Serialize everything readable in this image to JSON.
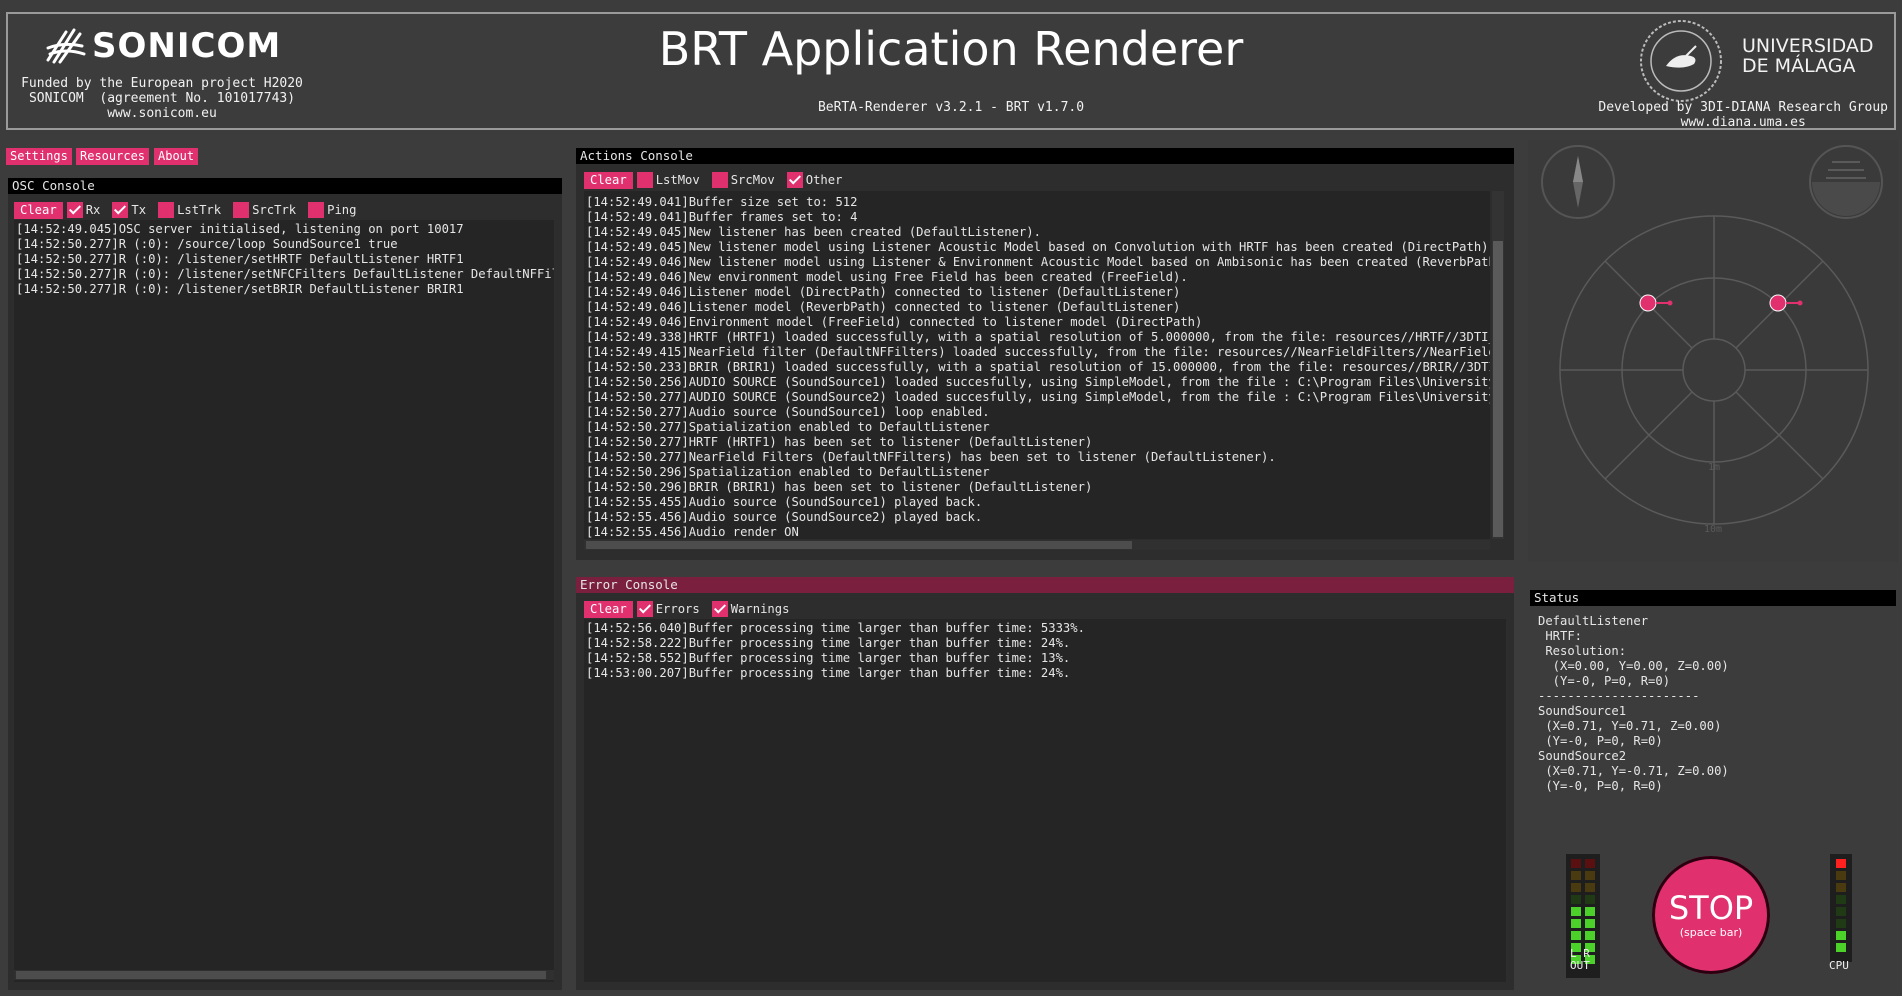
{
  "header": {
    "logo_text": "SONICOM",
    "funded_text": "Funded by the European project H2020\nSONICOM  (agreement No. 101017743)\nwww.sonicom.eu",
    "title": "BRT Application Renderer",
    "version": "BeRTA-Renderer v3.2.1 - BRT v1.7.0",
    "university": "UNIVERSIDAD\nDE MÁLAGA",
    "developed": "Developed by 3DI-DIANA Research Group\nwww.diana.uma.es"
  },
  "menu": {
    "settings": "Settings",
    "resources": "Resources",
    "about": "About"
  },
  "osc_console": {
    "title": "OSC Console",
    "clear": "Clear",
    "filters": [
      {
        "label": "Rx",
        "checked": true
      },
      {
        "label": "Tx",
        "checked": true
      },
      {
        "label": "LstTrk",
        "checked": false
      },
      {
        "label": "SrcTrk",
        "checked": false
      },
      {
        "label": "Ping",
        "checked": false
      }
    ],
    "log": "[14:52:49.045]OSC server initialised, listening on port 10017\n[14:52:50.277]R (:0): /source/loop SoundSource1 true\n[14:52:50.277]R (:0): /listener/setHRTF DefaultListener HRTF1\n[14:52:50.277]R (:0): /listener/setNFCFilters DefaultListener DefaultNFFilter\n[14:52:50.277]R (:0): /listener/setBRIR DefaultListener BRIR1"
  },
  "actions_console": {
    "title": "Actions Console",
    "clear": "Clear",
    "filters": [
      {
        "label": "LstMov",
        "checked": false
      },
      {
        "label": "SrcMov",
        "checked": false
      },
      {
        "label": "Other",
        "checked": true
      }
    ],
    "log": "[14:52:49.041]Buffer size set to: 512\n[14:52:49.041]Buffer frames set to: 4\n[14:52:49.045]New listener has been created (DefaultListener).\n[14:52:49.045]New listener model using Listener Acoustic Model based on Convolution with HRTF has been created (DirectPath).\n[14:52:49.046]New listener model using Listener & Environment Acoustic Model based on Ambisonic has been created (ReverbPath).\n[14:52:49.046]New environment model using Free Field has been created (FreeField).\n[14:52:49.046]Listener model (DirectPath) connected to listener (DefaultListener)\n[14:52:49.046]Listener model (ReverbPath) connected to listener (DefaultListener)\n[14:52:49.046]Environment model (FreeField) connected to listener model (DirectPath)\n[14:52:49.338]HRTF (HRTF1) loaded successfully, with a spatial resolution of 5.000000, from the file: resources//HRTF//3DTI_HRTF_S\n[14:52:49.415]NearField filter (DefaultNFFilters) loaded successfully, from the file: resources//NearFieldFilters//NearFieldCompen\n[14:52:50.233]BRIR (BRIR1) loaded successfully, with a spatial resolution of 15.000000, from the file: resources//BRIR//3DTI_BRIR_\n[14:52:50.256]AUDIO SOURCE (SoundSource1) loaded succesfully, using SimpleModel, from the file : C:\\Program Files\\University of Ma\n[14:52:50.277]AUDIO SOURCE (SoundSource2) loaded succesfully, using SimpleModel, from the file : C:\\Program Files\\University of Ma\n[14:52:50.277]Audio source (SoundSource1) loop enabled.\n[14:52:50.277]Spatialization enabled to DefaultListener\n[14:52:50.277]HRTF (HRTF1) has been set to listener (DefaultListener)\n[14:52:50.277]NearField Filters (DefaultNFFilters) has been set to listener (DefaultListener).\n[14:52:50.296]Spatialization enabled to DefaultListener\n[14:52:50.296]BRIR (BRIR1) has been set to listener (DefaultListener)\n[14:52:55.455]Audio source (SoundSource1) played back.\n[14:52:55.456]Audio source (SoundSource2) played back.\n[14:52:55.456]Audio render ON"
  },
  "error_console": {
    "title": "Error Console",
    "clear": "Clear",
    "filters": [
      {
        "label": "Errors",
        "checked": true
      },
      {
        "label": "Warnings",
        "checked": true
      }
    ],
    "log": "[14:52:56.040]Buffer processing time larger than buffer time: 5333%.\n[14:52:58.222]Buffer processing time larger than buffer time: 24%.\n[14:52:58.552]Buffer processing time larger than buffer time: 13%.\n[14:53:00.207]Buffer processing time larger than buffer time: 24%."
  },
  "radar": {
    "label_1m": "1m",
    "label_10m": "10m"
  },
  "status": {
    "title": "Status",
    "text": "DefaultListener\n HRTF:\n Resolution:\n  (X=0.00, Y=0.00, Z=0.00)\n  (Y=-0, P=0, R=0)\n----------------------\nSoundSource1\n (X=0.71, Y=0.71, Z=0.00)\n (Y=-0, P=0, R=0)\nSoundSource2\n (X=0.71, Y=-0.71, Z=0.00)\n (Y=-0, P=0, R=0)"
  },
  "meters": {
    "lr_label": "L R",
    "out_label": "OUT",
    "cpu_label": "CPU",
    "left_level": 0.5,
    "right_level": 0.5,
    "cpu_level": 0.3
  },
  "stop": {
    "label": "STOP",
    "hint": "(space bar)"
  },
  "colors": {
    "accent": "#e0306e",
    "background": "#3c3c3c",
    "console": "#252525",
    "error_header": "#7a1f3d"
  }
}
